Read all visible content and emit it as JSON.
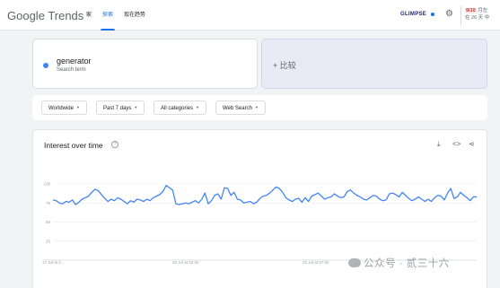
{
  "header": {
    "logo_google": "Google",
    "logo_trends": "Trends",
    "nav": [
      "家",
      "探索",
      "现在趋势"
    ],
    "glimpse_label": "GLIMPSE",
    "badge_count": "9/10",
    "badge_line1": " 月左",
    "badge_line2": "在 26 天 中"
  },
  "search_term": {
    "name": "generator",
    "subtitle": "Search term",
    "color": "#4285f4"
  },
  "compare": {
    "label": "+ 比较"
  },
  "filters": {
    "region": "Worldwide",
    "time": "Past 7 days",
    "category": "All categories",
    "search_type": "Web Search"
  },
  "chart_card": {
    "title": "Interest over time",
    "help_icon": "help-icon",
    "actions": [
      "download-icon",
      "embed-icon",
      "share-icon"
    ]
  },
  "chart_data": {
    "type": "line",
    "title": "Interest over time",
    "ylim": [
      0,
      100
    ],
    "y_ticks": [
      "100",
      "75",
      "50",
      "25"
    ],
    "x_ticks": [
      "17 Jul at 2...",
      "20 Jul at 02:00",
      "22 Jul at 07:00"
    ],
    "grid": true,
    "series": [
      {
        "name": "generator",
        "color": "#4285f4",
        "values": [
          79,
          78,
          75,
          74,
          77,
          76,
          79,
          73,
          76,
          80,
          82,
          84,
          89,
          93,
          91,
          86,
          81,
          77,
          80,
          78,
          82,
          80,
          77,
          74,
          78,
          76,
          80,
          79,
          77,
          80,
          78,
          82,
          84,
          86,
          90,
          98,
          95,
          92,
          74,
          73,
          74,
          75,
          74,
          76,
          78,
          75,
          80,
          88,
          74,
          78,
          85,
          87,
          80,
          95,
          94,
          85,
          89,
          80,
          79,
          75,
          76,
          77,
          74,
          76,
          81,
          84,
          85,
          88,
          92,
          96,
          94,
          89,
          82,
          79,
          77,
          80,
          81,
          76,
          82,
          77,
          84,
          86,
          88,
          84,
          80,
          82,
          83,
          87,
          84,
          82,
          83,
          90,
          92,
          88,
          85,
          83,
          80,
          79,
          82,
          85,
          84,
          80,
          78,
          79,
          87,
          88,
          86,
          83,
          89,
          85,
          81,
          78,
          80,
          83,
          80,
          77,
          80,
          77,
          82,
          85,
          84,
          79,
          88,
          94,
          81,
          83,
          89,
          85,
          82,
          78,
          83,
          83
        ]
      }
    ]
  },
  "watermark": {
    "text": "公众号 · 贰三十六"
  }
}
